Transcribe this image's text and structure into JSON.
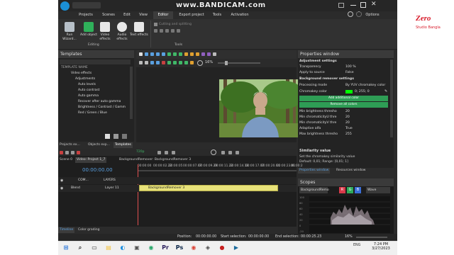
{
  "overlay": {
    "watermark": "www.BANDICAM.com",
    "channel_logo_main": "Zero",
    "channel_logo_sub": "Studio Bangla"
  },
  "menu": {
    "tabs": [
      "Projects",
      "Scenes",
      "Edit",
      "View",
      "Editor",
      "Export project",
      "Tools",
      "Activation"
    ],
    "active": "Editor",
    "options_label": "Options"
  },
  "ribbon": {
    "buttons": [
      {
        "label": "Run Wizard...",
        "icon": "wand-icon",
        "color": "#b7c0c8"
      },
      {
        "label": "Add object",
        "icon": "add-object-icon",
        "color": "#2fb05a"
      },
      {
        "label": "Video effects",
        "icon": "video-effects-icon",
        "color": "#e7e7e7"
      },
      {
        "label": "Audio effects",
        "icon": "audio-effects-icon",
        "color": "#e7e7e7"
      },
      {
        "label": "Text effects",
        "icon": "text-effects-icon",
        "color": "#e7e7e7"
      }
    ],
    "group_editing": "Editing",
    "tool_cutting": "Cutting and splitting",
    "group_tools": "Tools"
  },
  "templates": {
    "title": "Templates",
    "header": "TEMPLATE NAME",
    "items": [
      "Video effects",
      "Adjustments",
      "Auto levels",
      "Auto contrast",
      "Auto gamma",
      "Recover after auto gamma",
      "Brightness / Contrast / Gamm",
      "Red / Green / Blue"
    ],
    "tabs": [
      "Projects ex...",
      "Objects exp...",
      "Templates"
    ]
  },
  "preview": {
    "zoom": "16%"
  },
  "properties": {
    "title": "Properties window",
    "sections": [
      "Adjustment settings",
      "Background remover settings"
    ],
    "rows": [
      {
        "label": "Transparency",
        "value": "100 %"
      },
      {
        "label": "Apply to source",
        "value": "False"
      },
      {
        "label": "Processing mode",
        "value": "By YUV chromakey color"
      },
      {
        "label": "Chromakey color",
        "value": "0; 255; 0"
      }
    ],
    "btn_add": "Add additional color",
    "btn_remove": "Remove all colors",
    "rows2": [
      {
        "label": "Min brightness thresho",
        "value": "20"
      },
      {
        "label": "Min chromaticityU thre",
        "value": "20"
      },
      {
        "label": "Min chromaticityV thre",
        "value": "20"
      },
      {
        "label": "Adaptive alfa",
        "value": "True"
      },
      {
        "label": "Max brightness thresho",
        "value": "255"
      }
    ],
    "desc_title": "Similarity value",
    "desc_line1": "Set the chromakey similarity value",
    "desc_line2": "Default: 0,01; Range: [0,01; 1]",
    "tabs": [
      "Properties window",
      "Resources window"
    ],
    "chroma_color": "#00ff00"
  },
  "timeline": {
    "tabs": [
      "Scene 0",
      "Video: Project 1_7",
      "BackgroundRemover: BackgroundRemover 3"
    ],
    "fps": "720p",
    "time": "00:00:00.00",
    "ticks": [
      "00:00:00",
      "00:00:02.22",
      "00:00:05",
      "00:00:07.07",
      "00:00:09.29",
      "00:00:11.22",
      "00:00:14.18",
      "00:00:17.07",
      "00:00:20.04",
      "00:00:23.01",
      "00:00:2"
    ],
    "track_com": "COM...",
    "track_layers": "LAYERS",
    "blend": "Blend",
    "layer": "Layer 11",
    "clip": "BackgroundRemover 3"
  },
  "scopes": {
    "title": "Scopes",
    "source": "BackgroundRemo",
    "channels": [
      "R",
      "G",
      "B"
    ],
    "mode": "Wave",
    "y_labels": [
      "100",
      "80",
      "60",
      "40",
      "20",
      "0",
      "-20"
    ]
  },
  "bottom_tabs": [
    "Timeline",
    "Color grading"
  ],
  "status": {
    "position_label": "Position:",
    "position": "00:00:00.00",
    "start_label": "Start selection:",
    "start": "00:00:00.00",
    "end_label": "End selection:",
    "end": "00:00:25.23",
    "zoom": "16%"
  },
  "taskbar": {
    "time": "7:24 PM",
    "date": "3/27/2023",
    "lang": "ENG",
    "search_hint": "",
    "apps": [
      {
        "name": "start-button",
        "glyph": "⊞",
        "color": "#1e6fd9"
      },
      {
        "name": "search-app",
        "glyph": "⌕",
        "color": "#333"
      },
      {
        "name": "task-view",
        "glyph": "▭",
        "color": "#333"
      },
      {
        "name": "file-explorer",
        "glyph": "▤",
        "color": "#f3c23b"
      },
      {
        "name": "edge-app",
        "glyph": "◐",
        "color": "#1d8fe0"
      },
      {
        "name": "store-app",
        "glyph": "▣",
        "color": "#555"
      },
      {
        "name": "chrome-app",
        "glyph": "◉",
        "color": "#1fa463"
      },
      {
        "name": "premiere-app",
        "glyph": "Pr",
        "color": "#2a1f5c"
      },
      {
        "name": "photoshop-app",
        "glyph": "Ps",
        "color": "#0a2547"
      },
      {
        "name": "chrome-app-2",
        "glyph": "◉",
        "color": "#db4437"
      },
      {
        "name": "vsdc-app",
        "glyph": "◈",
        "color": "#444"
      },
      {
        "name": "record-app",
        "glyph": "●",
        "color": "#c72020"
      },
      {
        "name": "vsdc-app-2",
        "glyph": "▶",
        "color": "#1a6a9c"
      }
    ]
  }
}
